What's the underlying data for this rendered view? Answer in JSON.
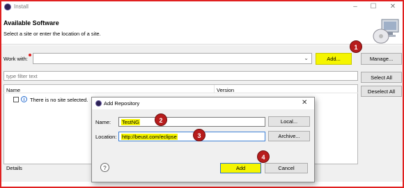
{
  "window": {
    "title": "Install",
    "minimize": "–",
    "maximize": "☐",
    "close": "✕"
  },
  "header": {
    "title": "Available Software",
    "subtitle": "Select a site or enter the location of a site."
  },
  "work_with": {
    "label": "Work with:",
    "value": "",
    "add_label": "Add...",
    "manage_label": "Manage..."
  },
  "filter": {
    "placeholder": "type filter text"
  },
  "side_buttons": {
    "select_all": "Select All",
    "deselect_all": "Deselect All"
  },
  "table": {
    "columns": [
      "Name",
      "Version"
    ],
    "rows": [
      {
        "text": "There is no site selected."
      }
    ]
  },
  "details": {
    "label": "Details"
  },
  "markers": [
    "1",
    "2",
    "3",
    "4"
  ],
  "dialog": {
    "title": "Add Repository",
    "name_label": "Name:",
    "name_value": "TestNG",
    "local_label": "Local...",
    "location_label": "Location:",
    "location_value": "http://beust.com/eclipse",
    "archive_label": "Archive...",
    "add_label": "Add",
    "cancel_label": "Cancel",
    "help_glyph": "?"
  },
  "colors": {
    "highlight": "#f5f500",
    "marker": "#b71c1c",
    "frame": "#e02020"
  }
}
